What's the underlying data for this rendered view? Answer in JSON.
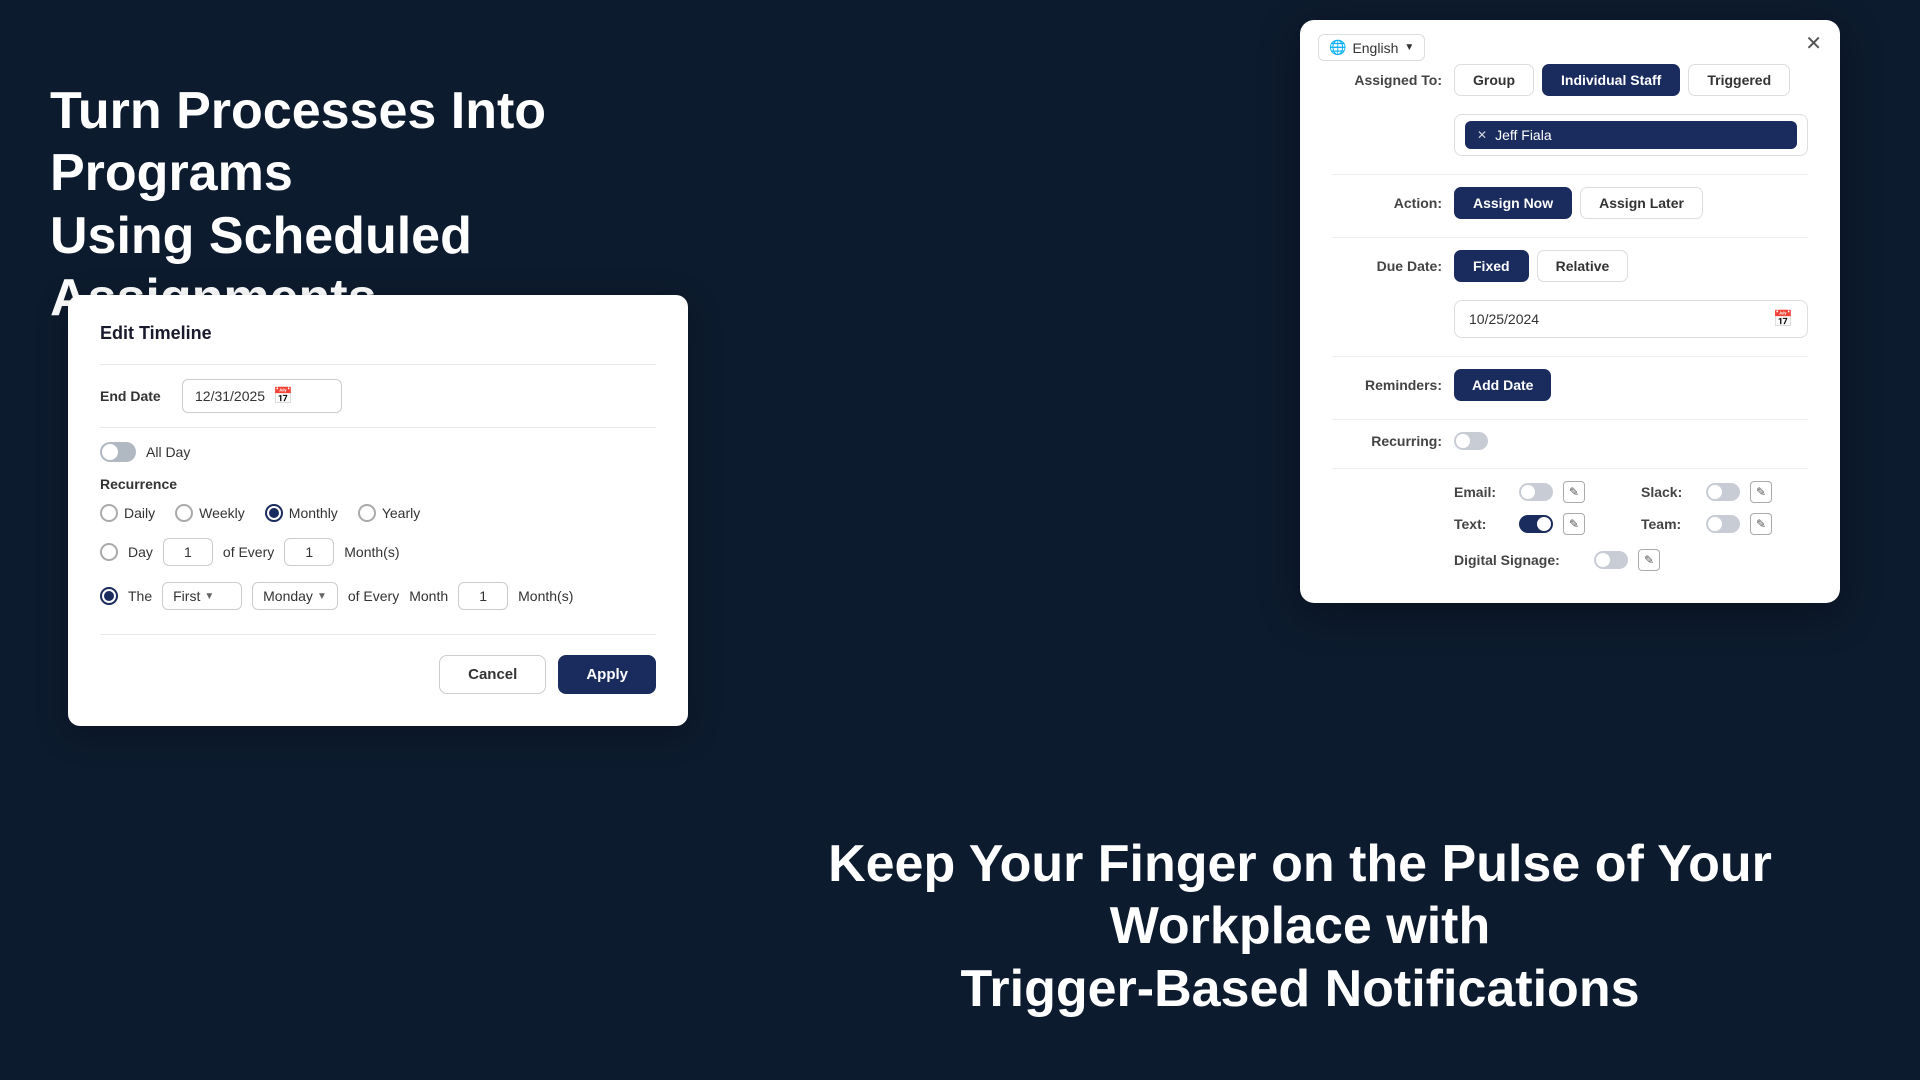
{
  "background": {
    "color": "#0d1b2e"
  },
  "hero": {
    "top_text_line1": "Turn Processes Into Programs",
    "top_text_line2": "Using Scheduled Assignments",
    "bottom_text_line1": "Keep Your Finger on the Pulse of Your Workplace with",
    "bottom_text_line2": "Trigger-Based Notifications"
  },
  "edit_timeline": {
    "title": "Edit Timeline",
    "end_date_label": "End Date",
    "end_date_value": "12/31/2025",
    "all_day_label": "All Day",
    "recurrence_label": "Recurrence",
    "recurrence_options": [
      "Daily",
      "Weekly",
      "Monthly",
      "Yearly"
    ],
    "recurrence_selected": "Monthly",
    "day_label": "Day",
    "of_every_label": "of Every",
    "month_s_label": "Month(s)",
    "day_value": "1",
    "months_value_1": "1",
    "the_label": "The",
    "first_option": "First",
    "day_option": "Monday",
    "of_every_label2": "of Every",
    "month_label": "Month",
    "months_value_2": "1",
    "month_s_label2": "Month(s)",
    "cancel_btn": "Cancel",
    "apply_btn": "Apply"
  },
  "assignment_panel": {
    "language": "English",
    "assigned_to_label": "Assigned To:",
    "tabs": [
      "Group",
      "Individual Staff",
      "Triggered"
    ],
    "active_tab": "Individual Staff",
    "staff_name": "Jeff Fiala",
    "action_label": "Action:",
    "action_options": [
      "Assign Now",
      "Assign Later"
    ],
    "active_action": "Assign Now",
    "due_date_label": "Due Date:",
    "due_date_options": [
      "Fixed",
      "Relative"
    ],
    "active_due_date": "Fixed",
    "date_value": "10/25/2024",
    "reminders_label": "Reminders:",
    "add_date_btn": "Add Date",
    "recurring_label": "Recurring:",
    "email_label": "Email:",
    "slack_label": "Slack:",
    "text_label": "Text:",
    "team_label": "Team:",
    "digital_signage_label": "Digital Signage:",
    "email_on": false,
    "slack_on": false,
    "text_on": true,
    "team_on": false,
    "digital_signage_on": false,
    "recurring_on": false
  }
}
